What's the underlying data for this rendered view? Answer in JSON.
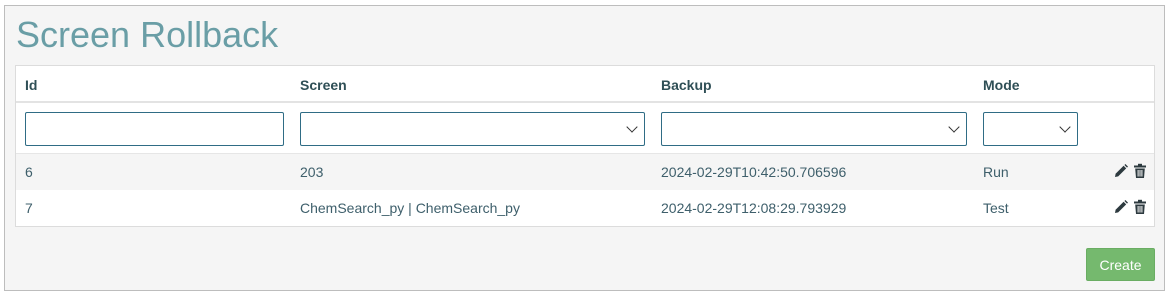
{
  "page": {
    "title": "Screen Rollback"
  },
  "table": {
    "columns": [
      "Id",
      "Screen",
      "Backup",
      "Mode"
    ],
    "filters": {
      "id_value": "",
      "screen_selected": "",
      "backup_selected": "",
      "mode_selected": ""
    },
    "rows": [
      {
        "id": "6",
        "screen": "203",
        "backup": "2024-02-29T10:42:50.706596",
        "mode": "Run"
      },
      {
        "id": "7",
        "screen": "ChemSearch_py | ChemSearch_py",
        "backup": "2024-02-29T12:08:29.793929",
        "mode": "Test"
      }
    ],
    "row_actions": [
      "pencil-icon",
      "trash-icon"
    ]
  },
  "footer": {
    "create_label": "Create"
  },
  "colors": {
    "title": "#6a9ea6",
    "header_text": "#2f4f56",
    "cell_text": "#3e5f6b",
    "input_border": "#2f6c85",
    "create_button": "#75b96e",
    "panel_background": "#f5f5f5"
  }
}
